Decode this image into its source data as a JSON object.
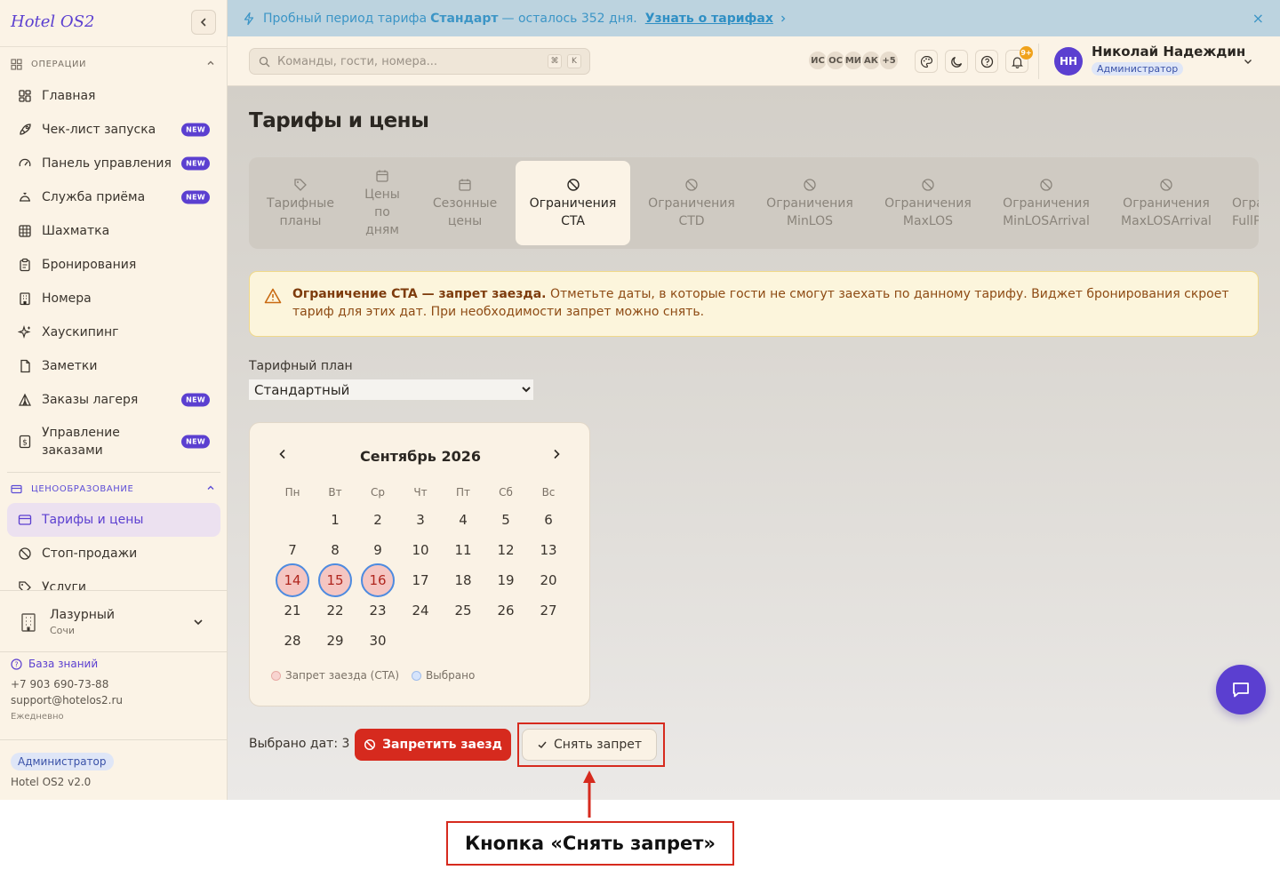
{
  "sidebar": {
    "logo": "Hotel OS2",
    "section_ops": "ОПЕРАЦИИ",
    "items": [
      {
        "label": "Главная",
        "badge": ""
      },
      {
        "label": "Чек-лист запуска",
        "badge": "NEW"
      },
      {
        "label": "Панель управления",
        "badge": "NEW"
      },
      {
        "label": "Служба приёма",
        "badge": "NEW"
      },
      {
        "label": "Шахматка",
        "badge": ""
      },
      {
        "label": "Бронирования",
        "badge": ""
      },
      {
        "label": "Номера",
        "badge": ""
      },
      {
        "label": "Хаускипинг",
        "badge": ""
      },
      {
        "label": "Заметки",
        "badge": ""
      },
      {
        "label": "Заказы лагеря",
        "badge": "NEW"
      },
      {
        "label": "Управление заказами",
        "badge": "NEW"
      }
    ],
    "section_pricing": "ЦЕНООБРАЗОВАНИЕ",
    "pricing_items": [
      {
        "label": "Тарифы и цены",
        "active": true
      },
      {
        "label": "Стоп-продажи",
        "active": false
      },
      {
        "label": "Услуги",
        "active": false
      }
    ],
    "hotel": {
      "name": "Лазурный",
      "city": "Сочи"
    },
    "support": {
      "kb_label": "База знаний",
      "phone": "+7 903 690-73-88",
      "email": "support@hotelos2.ru",
      "hours": "Ежедневно"
    },
    "role": "Администратор",
    "version": "Hotel OS2 v2.0"
  },
  "banner": {
    "prefix": "Пробный период тарифа",
    "plan": "Стандарт",
    "suffix": "— осталось 352 дня.",
    "link": "Узнать о тарифах",
    "close": "×"
  },
  "topbar": {
    "search_placeholder": "Команды, гости, номера...",
    "kbd1": "⌘",
    "kbd2": "K",
    "avatars": [
      "ИС",
      "ОС",
      "МИ",
      "АК",
      "+5"
    ],
    "notif_count": "9+",
    "user_initials": "НН",
    "user_name": "Николай Надеждин",
    "user_role": "Администратор"
  },
  "page": {
    "title": "Тарифы и цены",
    "tabs": [
      {
        "label": "Тарифные планы",
        "icon": "tag-icon"
      },
      {
        "label": "Цены по дням",
        "icon": "calendar-icon"
      },
      {
        "label": "Сезонные цены",
        "icon": "calendar-icon"
      },
      {
        "label": "Ограничения CTA",
        "icon": "ban-icon",
        "active": true
      },
      {
        "label": "Ограничения CTD",
        "icon": "ban-icon"
      },
      {
        "label": "Ограничения MinLOS",
        "icon": "ban-icon"
      },
      {
        "label": "Ограничения MaxLOS",
        "icon": "ban-icon"
      },
      {
        "label": "Ограничения MinLOSArrival",
        "icon": "ban-icon"
      },
      {
        "label": "Ограничения MaxLOSArrival",
        "icon": "ban-icon"
      },
      {
        "label": "Ограничения FullPa",
        "icon": "ban-icon"
      }
    ],
    "notice_bold": "Ограничение CTA — запрет заезда.",
    "notice_text": "Отметьте даты, в которые гости не смогут заехать по данному тарифу. Виджет бронирования скроет тариф для этих дат. При необходимости запрет можно снять.",
    "plan_label": "Тарифный план",
    "plan_value": "Стандартный",
    "calendar": {
      "month": "Сентябрь 2026",
      "weekdays": [
        "Пн",
        "Вт",
        "Ср",
        "Чт",
        "Пт",
        "Сб",
        "Вс"
      ],
      "first_weekday_index": 1,
      "days_in_month": 30,
      "selected_days": [
        14,
        15,
        16
      ]
    },
    "legend_cta": "Запрет заезда (CTA)",
    "legend_selected": "Выбрано",
    "selected_count": "Выбрано дат: 3",
    "btn_ban": "Запретить заезд",
    "btn_unban": "Снять запрет"
  },
  "annotation": {
    "callout": "Кнопка «Снять запрет»",
    "color": "#d62a1e"
  },
  "colors": {
    "accent": "#5b3fd0",
    "danger": "#d62a1e",
    "sidebar_bg": "#fbf3e6"
  }
}
